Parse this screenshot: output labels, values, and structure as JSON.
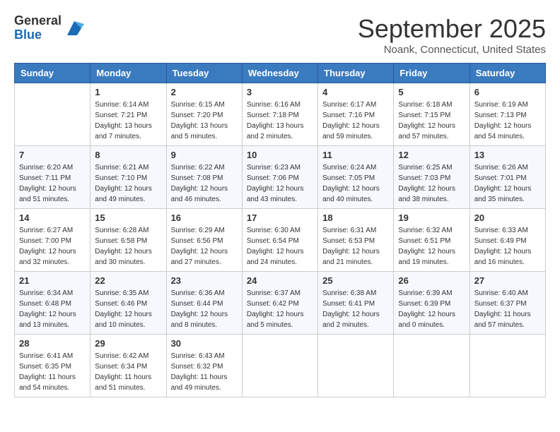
{
  "header": {
    "logo": {
      "general": "General",
      "blue": "Blue"
    },
    "month": "September 2025",
    "location": "Noank, Connecticut, United States"
  },
  "weekdays": [
    "Sunday",
    "Monday",
    "Tuesday",
    "Wednesday",
    "Thursday",
    "Friday",
    "Saturday"
  ],
  "weeks": [
    [
      {
        "day": "",
        "info": ""
      },
      {
        "day": "1",
        "info": "Sunrise: 6:14 AM\nSunset: 7:21 PM\nDaylight: 13 hours\nand 7 minutes."
      },
      {
        "day": "2",
        "info": "Sunrise: 6:15 AM\nSunset: 7:20 PM\nDaylight: 13 hours\nand 5 minutes."
      },
      {
        "day": "3",
        "info": "Sunrise: 6:16 AM\nSunset: 7:18 PM\nDaylight: 13 hours\nand 2 minutes."
      },
      {
        "day": "4",
        "info": "Sunrise: 6:17 AM\nSunset: 7:16 PM\nDaylight: 12 hours\nand 59 minutes."
      },
      {
        "day": "5",
        "info": "Sunrise: 6:18 AM\nSunset: 7:15 PM\nDaylight: 12 hours\nand 57 minutes."
      },
      {
        "day": "6",
        "info": "Sunrise: 6:19 AM\nSunset: 7:13 PM\nDaylight: 12 hours\nand 54 minutes."
      }
    ],
    [
      {
        "day": "7",
        "info": "Sunrise: 6:20 AM\nSunset: 7:11 PM\nDaylight: 12 hours\nand 51 minutes."
      },
      {
        "day": "8",
        "info": "Sunrise: 6:21 AM\nSunset: 7:10 PM\nDaylight: 12 hours\nand 49 minutes."
      },
      {
        "day": "9",
        "info": "Sunrise: 6:22 AM\nSunset: 7:08 PM\nDaylight: 12 hours\nand 46 minutes."
      },
      {
        "day": "10",
        "info": "Sunrise: 6:23 AM\nSunset: 7:06 PM\nDaylight: 12 hours\nand 43 minutes."
      },
      {
        "day": "11",
        "info": "Sunrise: 6:24 AM\nSunset: 7:05 PM\nDaylight: 12 hours\nand 40 minutes."
      },
      {
        "day": "12",
        "info": "Sunrise: 6:25 AM\nSunset: 7:03 PM\nDaylight: 12 hours\nand 38 minutes."
      },
      {
        "day": "13",
        "info": "Sunrise: 6:26 AM\nSunset: 7:01 PM\nDaylight: 12 hours\nand 35 minutes."
      }
    ],
    [
      {
        "day": "14",
        "info": "Sunrise: 6:27 AM\nSunset: 7:00 PM\nDaylight: 12 hours\nand 32 minutes."
      },
      {
        "day": "15",
        "info": "Sunrise: 6:28 AM\nSunset: 6:58 PM\nDaylight: 12 hours\nand 30 minutes."
      },
      {
        "day": "16",
        "info": "Sunrise: 6:29 AM\nSunset: 6:56 PM\nDaylight: 12 hours\nand 27 minutes."
      },
      {
        "day": "17",
        "info": "Sunrise: 6:30 AM\nSunset: 6:54 PM\nDaylight: 12 hours\nand 24 minutes."
      },
      {
        "day": "18",
        "info": "Sunrise: 6:31 AM\nSunset: 6:53 PM\nDaylight: 12 hours\nand 21 minutes."
      },
      {
        "day": "19",
        "info": "Sunrise: 6:32 AM\nSunset: 6:51 PM\nDaylight: 12 hours\nand 19 minutes."
      },
      {
        "day": "20",
        "info": "Sunrise: 6:33 AM\nSunset: 6:49 PM\nDaylight: 12 hours\nand 16 minutes."
      }
    ],
    [
      {
        "day": "21",
        "info": "Sunrise: 6:34 AM\nSunset: 6:48 PM\nDaylight: 12 hours\nand 13 minutes."
      },
      {
        "day": "22",
        "info": "Sunrise: 6:35 AM\nSunset: 6:46 PM\nDaylight: 12 hours\nand 10 minutes."
      },
      {
        "day": "23",
        "info": "Sunrise: 6:36 AM\nSunset: 6:44 PM\nDaylight: 12 hours\nand 8 minutes."
      },
      {
        "day": "24",
        "info": "Sunrise: 6:37 AM\nSunset: 6:42 PM\nDaylight: 12 hours\nand 5 minutes."
      },
      {
        "day": "25",
        "info": "Sunrise: 6:38 AM\nSunset: 6:41 PM\nDaylight: 12 hours\nand 2 minutes."
      },
      {
        "day": "26",
        "info": "Sunrise: 6:39 AM\nSunset: 6:39 PM\nDaylight: 12 hours\nand 0 minutes."
      },
      {
        "day": "27",
        "info": "Sunrise: 6:40 AM\nSunset: 6:37 PM\nDaylight: 11 hours\nand 57 minutes."
      }
    ],
    [
      {
        "day": "28",
        "info": "Sunrise: 6:41 AM\nSunset: 6:35 PM\nDaylight: 11 hours\nand 54 minutes."
      },
      {
        "day": "29",
        "info": "Sunrise: 6:42 AM\nSunset: 6:34 PM\nDaylight: 11 hours\nand 51 minutes."
      },
      {
        "day": "30",
        "info": "Sunrise: 6:43 AM\nSunset: 6:32 PM\nDaylight: 11 hours\nand 49 minutes."
      },
      {
        "day": "",
        "info": ""
      },
      {
        "day": "",
        "info": ""
      },
      {
        "day": "",
        "info": ""
      },
      {
        "day": "",
        "info": ""
      }
    ]
  ]
}
